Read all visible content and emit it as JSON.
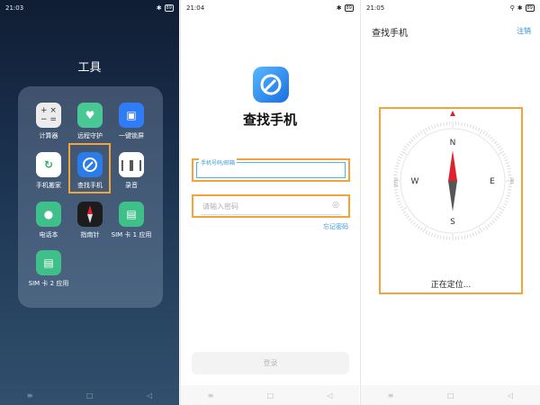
{
  "screen1": {
    "status": {
      "time": "21:03",
      "battery": "89"
    },
    "folder_title": "工具",
    "apps": [
      {
        "label": "计算器",
        "icon": "calculator-icon",
        "glyph": "±",
        "color": "#e9e9e9"
      },
      {
        "label": "远程守护",
        "icon": "heart-shield-icon",
        "glyph": "♥",
        "color": "#49c795"
      },
      {
        "label": "一键锁屏",
        "icon": "lock-icon",
        "glyph": "🔒",
        "color": "#2f7cf6"
      },
      {
        "label": "手机搬家",
        "icon": "phone-clone-icon",
        "glyph": "↻",
        "color": "#ffffff"
      },
      {
        "label": "查找手机",
        "icon": "find-phone-icon",
        "glyph": "◉",
        "color": "#2a7de8"
      },
      {
        "label": "录音",
        "icon": "recorder-icon",
        "glyph": "♪",
        "color": "#ffffff"
      },
      {
        "label": "电话本",
        "icon": "contacts-icon",
        "glyph": "👤",
        "color": "#3fbf8a"
      },
      {
        "label": "指南针",
        "icon": "compass-app-icon",
        "glyph": "✦",
        "color": "#1c1c1c"
      },
      {
        "label": "SIM 卡 1 应用",
        "icon": "sim1-icon",
        "glyph": "▣",
        "color": "#3fbf8a"
      },
      {
        "label": "SIM 卡 2 应用",
        "icon": "sim2-icon",
        "glyph": "▣",
        "color": "#3fbf8a"
      }
    ],
    "nav": [
      "≡",
      "□",
      "◁"
    ]
  },
  "screen2": {
    "status": {
      "time": "21:04",
      "battery": "89"
    },
    "title": "查找手机",
    "account_label": "手机号码/邮箱",
    "password_placeholder": "请输入密码",
    "forgot": "忘记密码",
    "login": "登录",
    "nav": [
      "≡",
      "□",
      "◁"
    ]
  },
  "screen3": {
    "status": {
      "time": "21:05",
      "battery": "89"
    },
    "title": "查找手机",
    "logout": "注销",
    "compass": {
      "N": "N",
      "S": "S",
      "E": "E",
      "W": "W",
      "deg_left": "270",
      "deg_right": "90"
    },
    "locating": "正在定位...",
    "nav": [
      "≡",
      "□",
      "◁"
    ]
  },
  "colors": {
    "accent": "#2d8fd5",
    "highlight": "#f2a33a",
    "needle_red": "#e0202b"
  }
}
